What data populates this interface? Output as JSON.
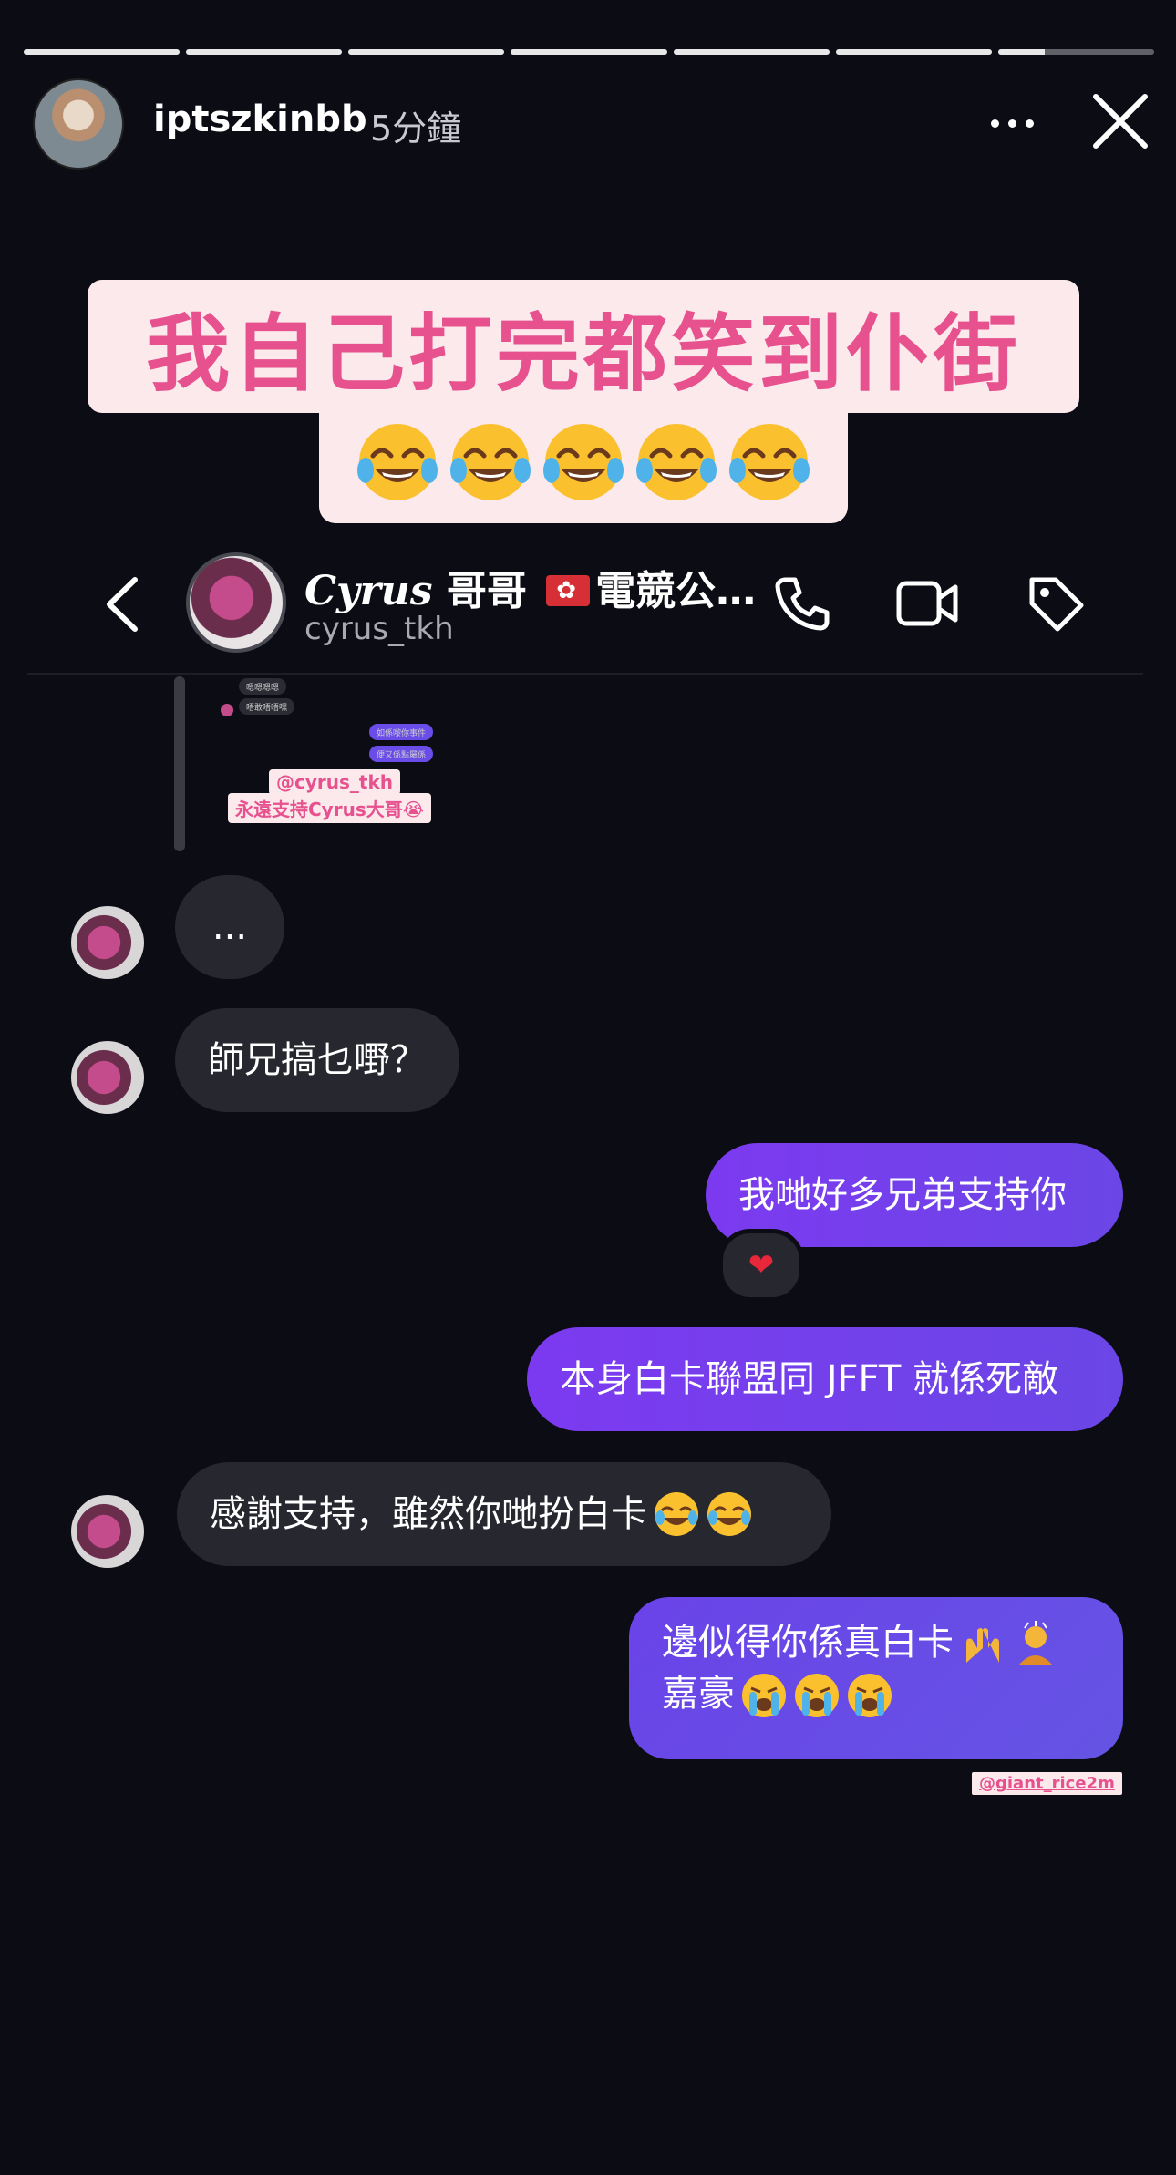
{
  "story": {
    "segments": [
      1,
      1,
      1,
      1,
      1,
      1,
      0.3
    ],
    "username": "iptszkinbb",
    "time_ago": "5分鐘"
  },
  "captions": {
    "line1": "我自己打完都笑到仆街",
    "laugh_emoji_count": 5,
    "laugh_icon": "face-with-tears-of-joy-icon"
  },
  "chat_header": {
    "contact_name_latin": "Cyrus",
    "contact_name_rest": "哥哥",
    "contact_name_tail": "電競公…",
    "handle": "cyrus_tkh"
  },
  "embedded_story": {
    "mini_lines": [
      "嗯嗯嗯嗯",
      "唔敢唔唔嘿",
      "如係嚟你事件",
      "便又係點屬係"
    ],
    "tag1": "@cyrus_tkh",
    "tag2": "永遠支持Cyrus大哥😭"
  },
  "messages": [
    {
      "side": "in",
      "text": "..."
    },
    {
      "side": "in",
      "text": "師兄搞乜嘢？"
    },
    {
      "side": "out",
      "text": "我哋好多兄弟支持你",
      "reaction": "❤"
    },
    {
      "side": "out",
      "text": "本身白卡聯盟同 JFFT 就係死敵"
    },
    {
      "side": "in",
      "text": "感謝支持，雖然你哋扮白卡"
    },
    {
      "side": "out",
      "text_line1": "邊似得你係真白卡",
      "text_line2": "嘉豪"
    }
  ],
  "watermark": "@giant_rice2m",
  "colors": {
    "background": "#0c0d14",
    "caption_bg": "#fbe9ec",
    "caption_text": "#e6518e",
    "outgoing_bubble": "#6f42e9",
    "incoming_bubble": "#26272f"
  }
}
